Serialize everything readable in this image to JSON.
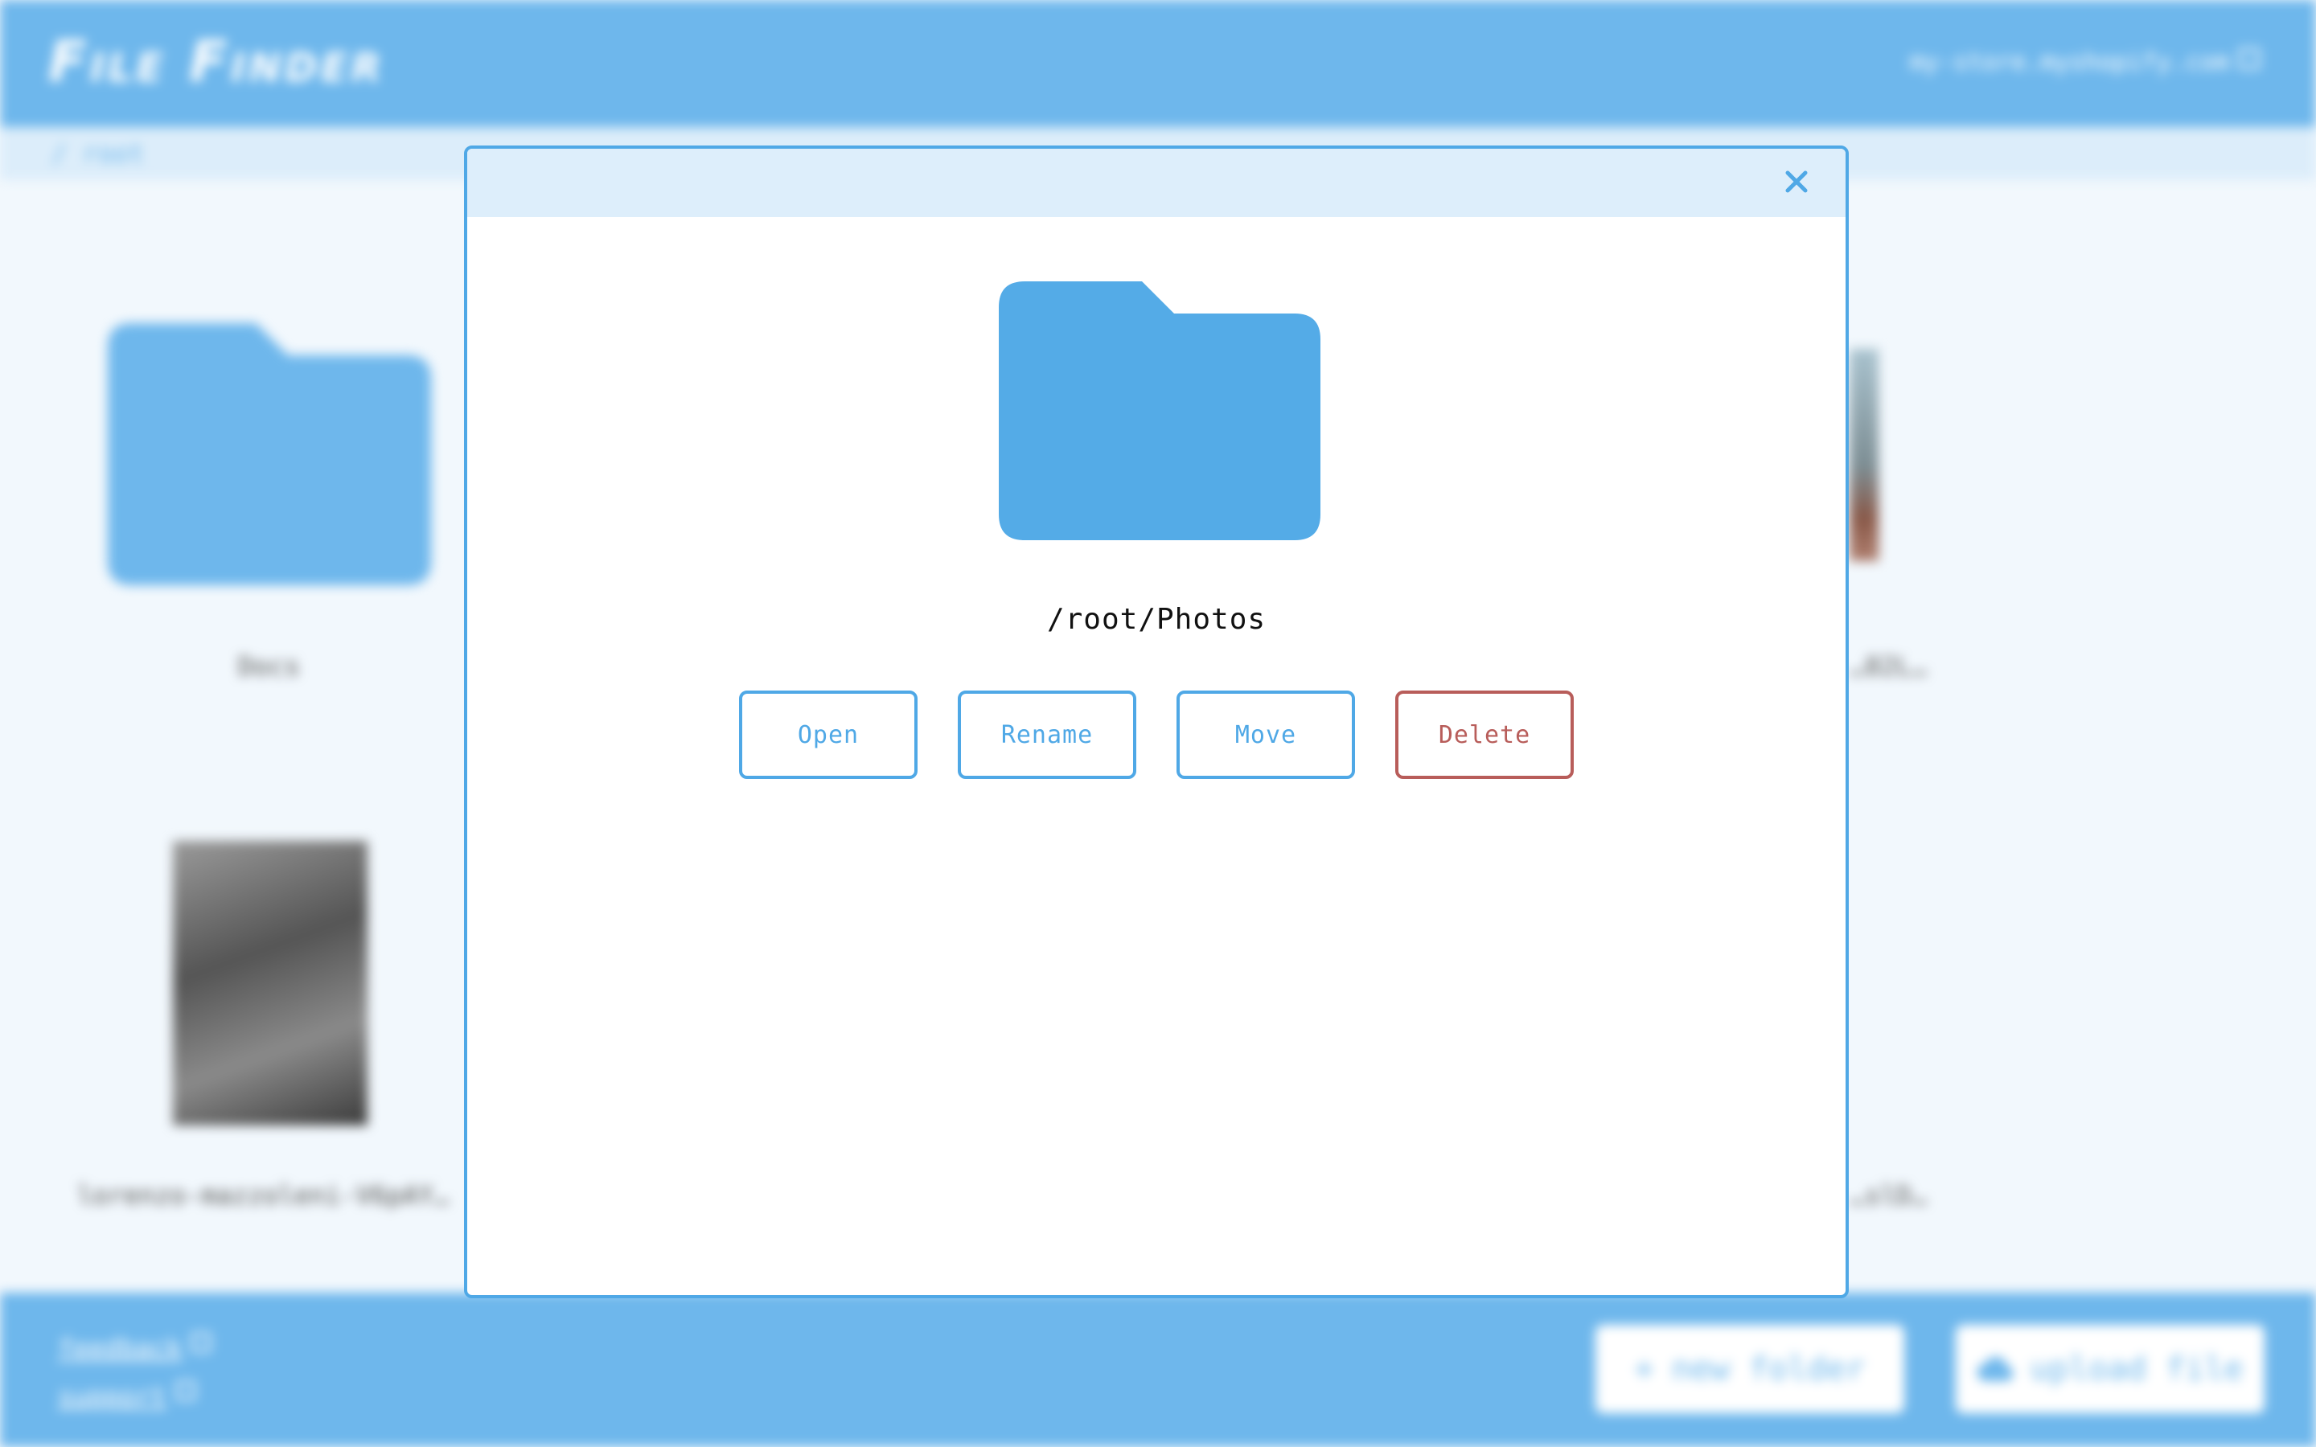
{
  "app": {
    "logo": "File Finder",
    "store": "my-store.myshopify.com",
    "breadcrumb": "/ root"
  },
  "background_grid": [
    {
      "type": "folder",
      "label": "Docs"
    },
    {
      "type": "image",
      "label": "…02L…"
    },
    {
      "type": "image",
      "label": "lorenzo-mazzoleni-V6pAY…"
    },
    {
      "type": "image",
      "label": "…slD…"
    }
  ],
  "footer": {
    "links": [
      "feedback",
      "support"
    ],
    "new_folder_label": "new folder",
    "upload_file_label": "upload file",
    "new_folder_icon": "plus-icon",
    "upload_file_icon": "cloud-upload-icon"
  },
  "modal": {
    "path": "/root/Photos",
    "item_icon": "folder-icon",
    "close_icon": "close-icon",
    "actions": {
      "open": "Open",
      "rename": "Rename",
      "move": "Move",
      "delete": "Delete"
    }
  },
  "colors": {
    "accent": "#4fa8e6",
    "bar": "#6eb7ec",
    "danger": "#b85d5a",
    "folder_fill": "#54abe7"
  }
}
